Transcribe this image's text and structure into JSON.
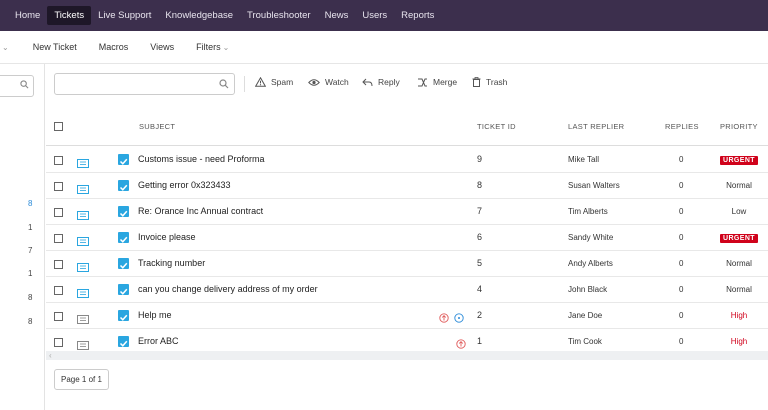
{
  "topnav": {
    "items": [
      "Home",
      "Tickets",
      "Live Support",
      "Knowledgebase",
      "Troubleshooter",
      "News",
      "Users",
      "Reports"
    ],
    "active": "Tickets"
  },
  "subnav": {
    "new_ticket": "New Ticket",
    "macros": "Macros",
    "views": "Views",
    "filters": "Filters"
  },
  "sidebar": {
    "counts": [
      "8",
      "1",
      "7",
      "1",
      "8",
      "8"
    ]
  },
  "toolbar": {
    "search_placeholder": "",
    "spam": "Spam",
    "watch": "Watch",
    "reply": "Reply",
    "merge": "Merge",
    "trash": "Trash"
  },
  "table": {
    "headers": {
      "subject": "SUBJECT",
      "ticket_id": "TICKET ID",
      "last_replier": "LAST REPLIER",
      "replies": "REPLIES",
      "priority": "PRIORITY"
    },
    "rows": [
      {
        "subject": "Customs issue - need Proforma",
        "ticket_id": "9",
        "last_replier": "Mike Tall",
        "replies": "0",
        "priority": "URGENT",
        "prio_style": "urgent"
      },
      {
        "subject": "Getting error 0x323433",
        "ticket_id": "8",
        "last_replier": "Susan Walters",
        "replies": "0",
        "priority": "Normal",
        "prio_style": "normal"
      },
      {
        "subject": "Re: Orance Inc Annual contract",
        "ticket_id": "7",
        "last_replier": "Tim Alberts",
        "replies": "0",
        "priority": "Low",
        "prio_style": "normal"
      },
      {
        "subject": "Invoice please",
        "ticket_id": "6",
        "last_replier": "Sandy White",
        "replies": "0",
        "priority": "URGENT",
        "prio_style": "urgent"
      },
      {
        "subject": "Tracking number",
        "ticket_id": "5",
        "last_replier": "Andy Alberts",
        "replies": "0",
        "priority": "Normal",
        "prio_style": "normal"
      },
      {
        "subject": "can you change delivery address of my order",
        "ticket_id": "4",
        "last_replier": "John Black",
        "replies": "0",
        "priority": "Normal",
        "prio_style": "normal"
      },
      {
        "subject": "Help me",
        "ticket_id": "2",
        "last_replier": "Jane Doe",
        "replies": "0",
        "priority": "High",
        "prio_style": "high"
      },
      {
        "subject": "Error ABC",
        "ticket_id": "1",
        "last_replier": "Tim Cook",
        "replies": "0",
        "priority": "High",
        "prio_style": "high"
      }
    ]
  },
  "pager": {
    "label": "Page 1 of 1"
  },
  "colors": {
    "nav_bg": "#3c2f4d",
    "accent": "#2aa6e0",
    "urgent": "#d0021b"
  }
}
